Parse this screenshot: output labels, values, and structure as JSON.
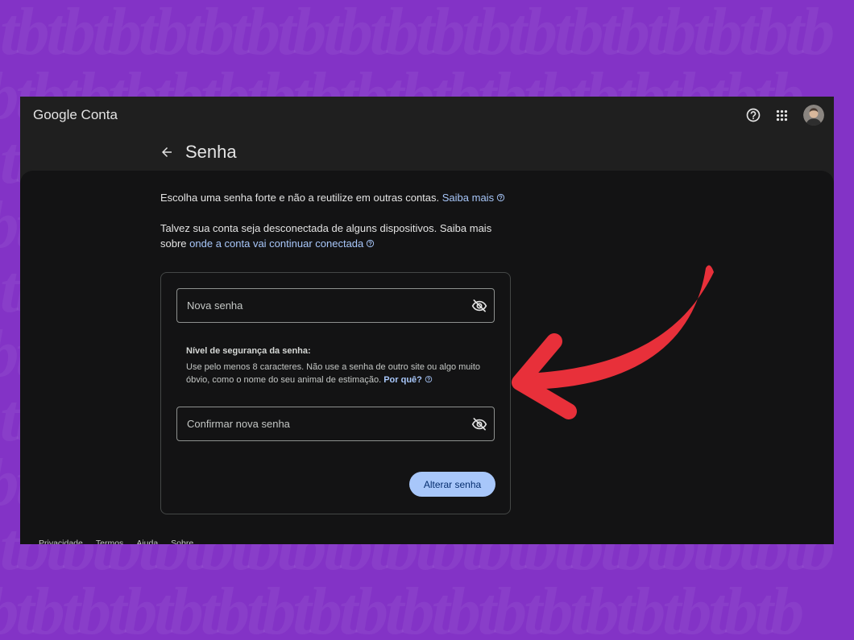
{
  "watermark": {
    "text": "tb"
  },
  "colors": {
    "page_background": "#8333c6",
    "header_background": "#1f1f1f",
    "panel_background": "#131314",
    "link": "#a8c7fa",
    "button_background": "#a8c7fa",
    "button_text": "#062e6f",
    "annotation_arrow": "#e8303a"
  },
  "header": {
    "title": "Google Conta",
    "icons": {
      "help": "help-circle-icon",
      "apps": "apps-grid-icon",
      "account": "account-avatar"
    }
  },
  "page": {
    "back_icon": "arrow-back-icon",
    "title": "Senha"
  },
  "intro": {
    "line1_text": "Escolha uma senha forte e não a reutilize em outras contas.",
    "line1_link": "Saiba mais",
    "line2_text": "Talvez sua conta seja desconectada de alguns dispositivos. Saiba mais",
    "line3_text": "sobre",
    "line3_link": "onde a conta vai continuar conectada",
    "info_icon": "help-circle-icon"
  },
  "form": {
    "new_password": {
      "placeholder": "Nova senha",
      "toggle_icon": "eye-off-icon"
    },
    "strength": {
      "title": "Nível de segurança da senha:",
      "line1": "Use pelo menos 8 caracteres. Não use a senha de outro site ou algo muito",
      "line2": "óbvio, como o nome do seu animal de estimação.",
      "link": "Por quê?"
    },
    "confirm_password": {
      "placeholder": "Confirmar nova senha",
      "toggle_icon": "eye-off-icon"
    },
    "submit_label": "Alterar senha"
  },
  "footer": {
    "links": [
      "Privacidade",
      "Termos",
      "Ajuda",
      "Sobre"
    ]
  }
}
